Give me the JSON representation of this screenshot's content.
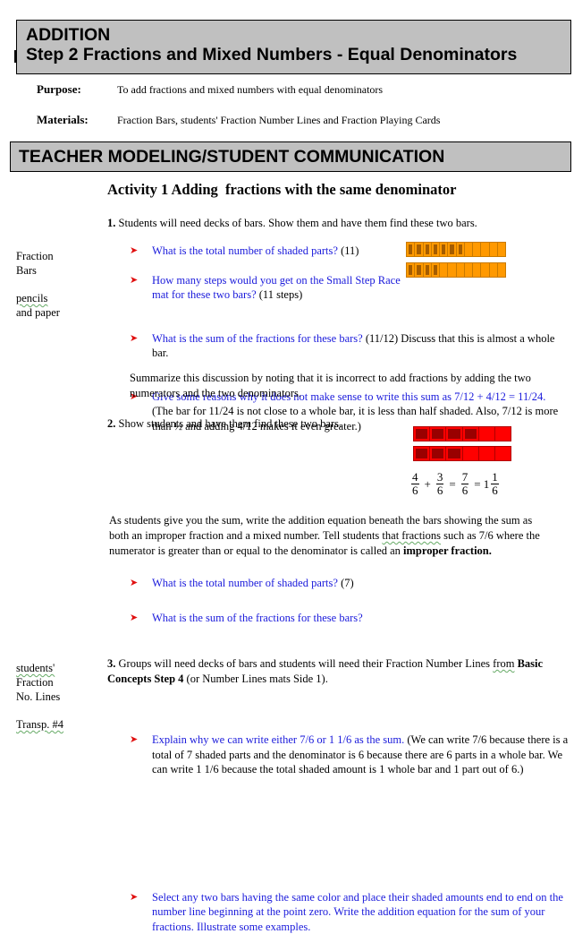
{
  "header": {
    "title_line1": "ADDITION",
    "title_line2": "Step 2 Fractions and Mixed Numbers - Equal Denominators"
  },
  "purpose": {
    "label": "Purpose:",
    "text": "To add fractions and mixed numbers with equal denominators"
  },
  "materials": {
    "label": "Materials:",
    "text": "Fraction Bars, students' Fraction Number Lines and Fraction Playing Cards"
  },
  "section": {
    "title": "TEACHER MODELING/STUDENT COMMUNICATION"
  },
  "activity": {
    "title": "Activity 1 Adding  fractions with the same denominator"
  },
  "sidebar": {
    "group1": [
      "Fraction",
      "Bars"
    ],
    "group2": [
      "pencils",
      "and paper"
    ],
    "group3": [
      "students'",
      "Fraction",
      "No. Lines"
    ],
    "group4": [
      "Transp. #4"
    ]
  },
  "step1": {
    "number": "1.",
    "intro": " Students will need decks of bars. Show them and have them find these two bars.",
    "bullets": [
      {
        "q": "What is the total number of shaded parts?",
        "a": " (11)"
      },
      {
        "q": "How many steps would you get on the Small Step Race mat for these two bars?",
        "a": " (11 steps)"
      },
      {
        "q": "What is the sum of the fractions for these bars?",
        "a": " (11/12) Discuss  that this is almost a whole bar."
      },
      {
        "q": "Give some reasons why it does not make sense to write this sum as 7/12 + 4/12 = 11/24.",
        "a": " (The  bar for 11/24 is not close to a whole bar, it is less than half shaded. Also, 7/12 is more  than ½  and adding 4/12 makes it even greater.)"
      }
    ],
    "summary": "Summarize  this discussion by noting that it is incorrect to add fractions by adding the two numerators  and the two denominators.",
    "bars": [
      {
        "parts": 12,
        "shaded": 7,
        "color": "#ff9900",
        "shade_color": "#a45c00"
      },
      {
        "parts": 12,
        "shaded": 4,
        "color": "#ff9900",
        "shade_color": "#a45c00"
      }
    ]
  },
  "step2": {
    "number": "2.",
    "intro": " Show students and have them find these two bars.",
    "bullets": [
      {
        "q": "What is the total number of shaded parts?",
        "a": " (7)"
      },
      {
        "q": "What is the sum of the fractions for these bars?",
        "a": ""
      }
    ],
    "bars": [
      {
        "parts": 6,
        "shaded": 4,
        "color": "#ff0000",
        "shade_color": "#990000"
      },
      {
        "parts": 6,
        "shaded": 3,
        "color": "#ff0000",
        "shade_color": "#990000"
      }
    ],
    "equation": {
      "a_num": "4",
      "a_den": "6",
      "plus": "+",
      "b_num": "3",
      "b_den": "6",
      "eq1": "=",
      "c_num": "7",
      "c_den": "6",
      "eq2": "= 1",
      "d_num": "1",
      "d_den": "6"
    },
    "para_before": "As students give you the sum, write  the addition equation beneath the bars showing  the sum as both an improper fraction  and a mixed  number. Tell students ",
    "para_squig": "that fractions",
    "para_after": " such as 7/6 where  the numerator is greater than or equal to the denominator is called an ",
    "para_bold": "improper  fraction.",
    "explain": {
      "q": "Explain why we can write either 7/6 or 1 1/6 as the sum.",
      "a": " (We  can  write 7/6 because there is a total of 7 shaded parts and the denominator is 6 because there are 6 parts in a whole bar. We can write  1 1/6 because the total shaded amount is 1 whole bar and 1 part out of 6.)"
    }
  },
  "step3": {
    "number": "3.",
    "intro1": " Groups  will need decks of bars and students will need their Fraction Number Lines ",
    "from": "from",
    "bold": " Basic Concepts  Step 4",
    "intro2": " (or Number Lines mats Side 1).",
    "bullet": "Select any two bars having the same  color and place their shaded amounts end to end on the number line beginning at the point zero. Write the addition equation for the sum  of your fractions. Illustrate  some examples."
  }
}
